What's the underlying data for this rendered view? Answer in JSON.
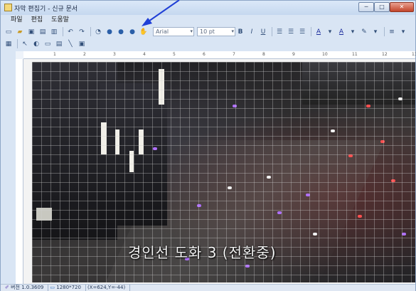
{
  "window": {
    "title": "자막 편집기 - 신규 문서",
    "minimize_label": "─",
    "maximize_label": "□",
    "close_label": "✕"
  },
  "menu": {
    "items": [
      {
        "label": "파일"
      },
      {
        "label": "편집"
      },
      {
        "label": "도움말"
      }
    ]
  },
  "toolbar": {
    "font_name": "Arial",
    "font_size": "10 pt",
    "bold_label": "B",
    "italic_label": "I",
    "underline_label": "U",
    "text_color_label": "A",
    "line_style_label": "≡"
  },
  "ruler": {
    "marks": [
      "1",
      "2",
      "3",
      "4",
      "5",
      "6",
      "7",
      "8",
      "9",
      "10",
      "11",
      "12",
      "13"
    ]
  },
  "video": {
    "caption": "경인선  도화  3  (전환중)"
  },
  "status": {
    "version": "버전 1.0.3609",
    "resolution": "1280*720",
    "coords": "(X=624,Y=-44)"
  },
  "colors": {
    "accent": "#1f3fd6",
    "window_frame": "#d9e5f4"
  }
}
